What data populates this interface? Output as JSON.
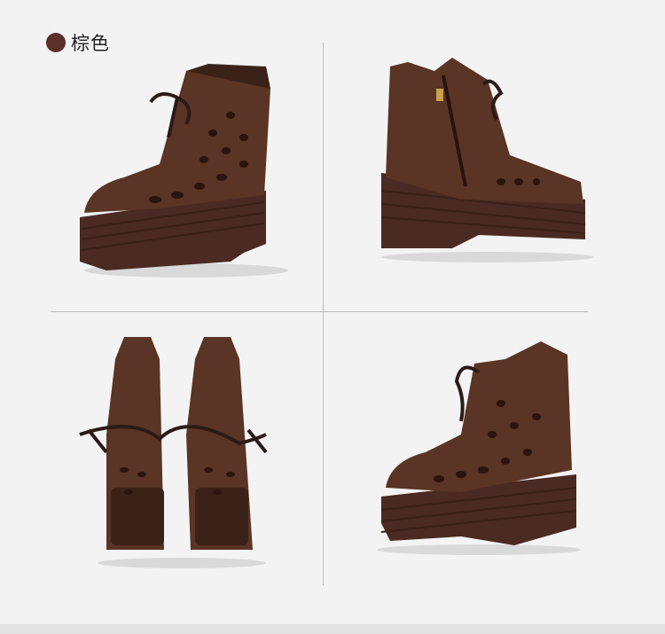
{
  "header": {
    "color_label": "棕色",
    "swatch_color": "#5c2f2a",
    "swatch_icon": "color-dot-icon"
  },
  "gallery": {
    "images": [
      {
        "name": "boot-front-three-quarter-view",
        "icon": "boot-image"
      },
      {
        "name": "boot-inner-side-zipper-view",
        "icon": "boot-image"
      },
      {
        "name": "boots-top-down-pair-view",
        "icon": "boot-image"
      },
      {
        "name": "boot-outer-side-view",
        "icon": "boot-image"
      }
    ]
  },
  "colors": {
    "background": "#f3f3f3",
    "leather": "#5a3424",
    "leather_dark": "#3b2219",
    "sole": "#4a2a22",
    "divider": "#bdbdbd"
  }
}
